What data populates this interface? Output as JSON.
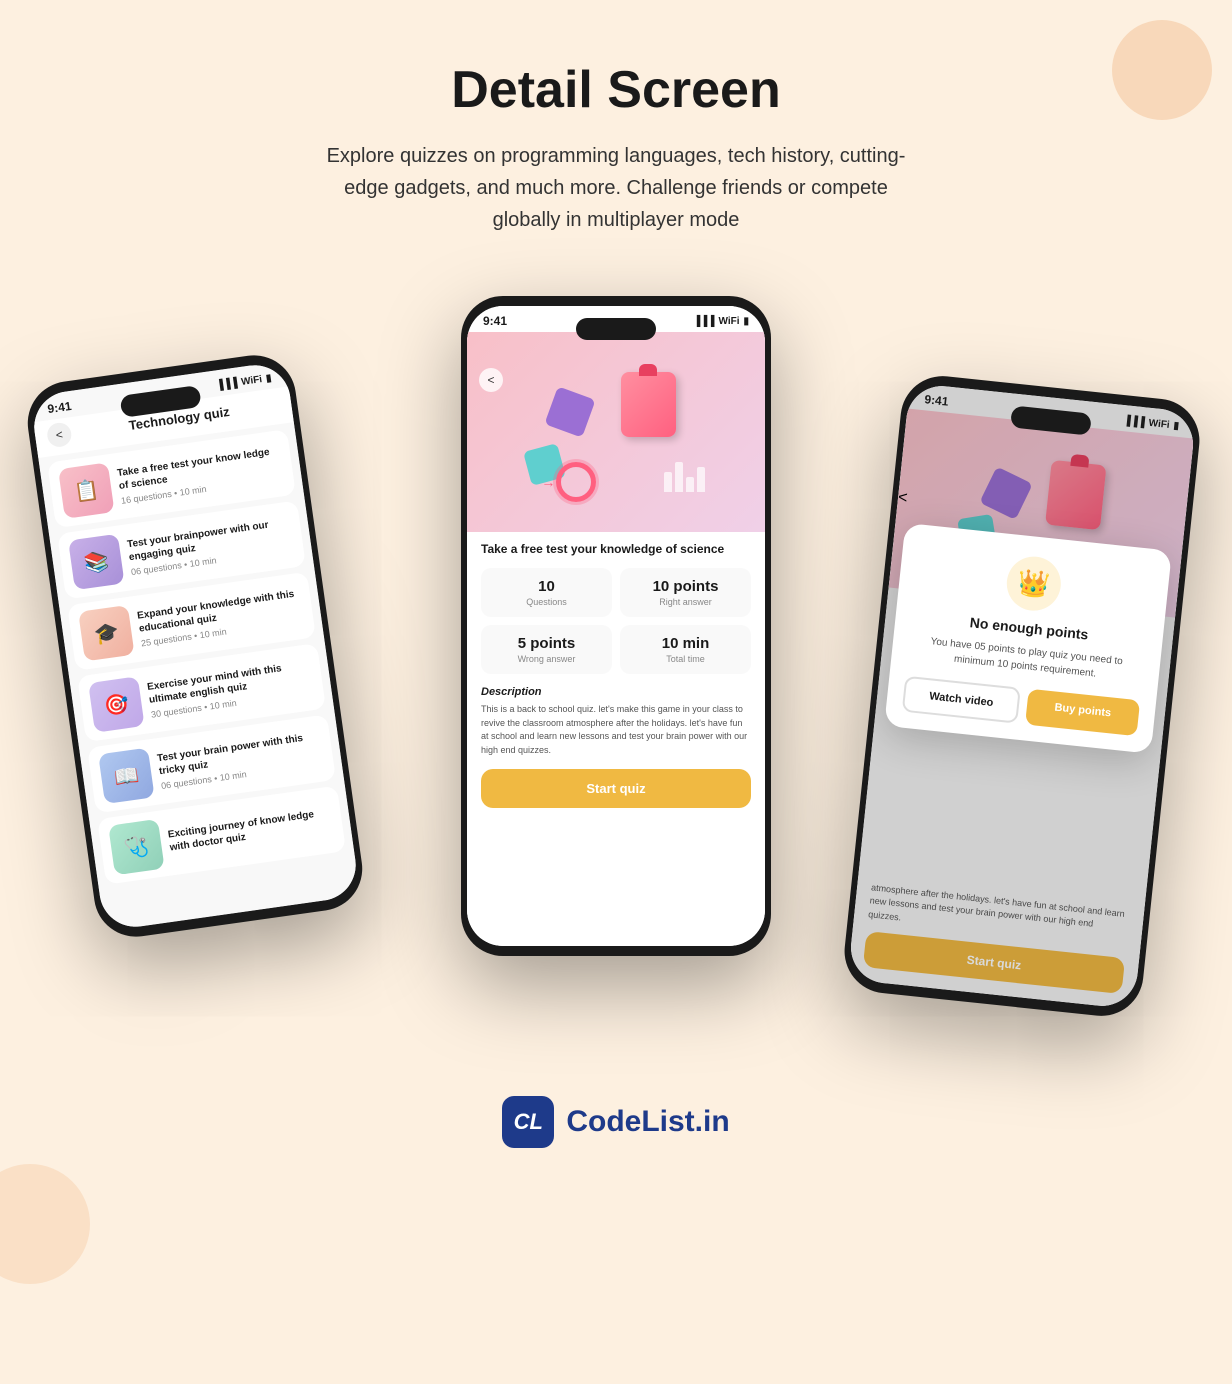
{
  "page": {
    "title": "Detail Screen",
    "subtitle": "Explore quizzes on programming languages, tech history, cutting-edge gadgets, and much more. Challenge friends or compete globally in multiplayer mode"
  },
  "phone_left": {
    "status_time": "9:41",
    "header_title": "Technology quiz",
    "back_label": "<",
    "quiz_items": [
      {
        "title": "Take a free test your know ledge of science",
        "meta": "16 questions • 10 min",
        "thumb_class": "thumb-pink",
        "emoji": "📋"
      },
      {
        "title": "Test your brainpower with our engaging quiz",
        "meta": "06 questions • 10 min",
        "thumb_class": "thumb-purple",
        "emoji": "📚"
      },
      {
        "title": "Expand your knowledge with this educational quiz",
        "meta": "25 questions • 10 min",
        "thumb_class": "thumb-peach",
        "emoji": "🎓"
      },
      {
        "title": "Exercise your mind with this ultimate english quiz",
        "meta": "30 questions • 10 min",
        "thumb_class": "thumb-lavender",
        "emoji": "🎯"
      },
      {
        "title": "Test your brain power with this tricky quiz",
        "meta": "06 questions • 10 min",
        "thumb_class": "thumb-blue",
        "emoji": "📖"
      },
      {
        "title": "Exciting journey of know ledge with doctor quiz",
        "meta": "",
        "thumb_class": "thumb-mint",
        "emoji": "🩺"
      }
    ]
  },
  "phone_center": {
    "status_time": "9:41",
    "back_label": "<",
    "quiz_title": "Take a free test your knowledge of science",
    "stats": [
      {
        "value": "10",
        "label": "Questions"
      },
      {
        "value": "10 points",
        "label": "Right answer"
      },
      {
        "value": "5 points",
        "label": "Wrong answer"
      },
      {
        "value": "10 min",
        "label": "Total time"
      }
    ],
    "description_title": "Description",
    "description_text": "This is a back to school quiz. let's make this game in your class to revive the classroom atmosphere after the holidays. let's have fun at school and learn new lessons and test your brain power with our high end quizzes.",
    "start_button": "Start quiz"
  },
  "phone_right": {
    "status_time": "9:41",
    "back_label": "<",
    "popup": {
      "icon": "👑",
      "title": "No enough points",
      "text": "You have 05 points to play quiz you need to minimum 10 points requirement.",
      "watch_button": "Watch video",
      "buy_button": "Buy points"
    },
    "bottom_text": "atmosphere after the holidays. let's have fun at school and learn new lessons and test your brain power with our high end quizzes.",
    "start_button": "Start quiz"
  },
  "footer": {
    "logo_letter": "CL",
    "brand_name": "CodeList.in"
  }
}
